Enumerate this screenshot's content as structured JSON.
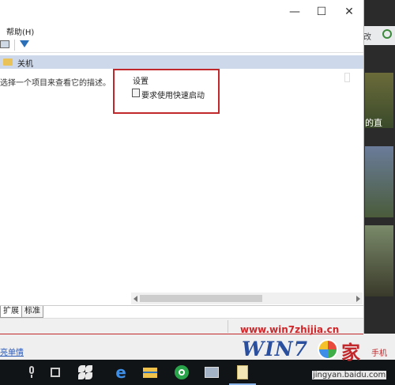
{
  "window": {
    "menu": {
      "help": "帮助(H)"
    },
    "header_row": {
      "label": "关机"
    },
    "description": "选择一个项目来查看它的描述。",
    "settings": {
      "heading": "设置",
      "item": "要求使用快速启动"
    },
    "tabs": [
      {
        "label": "扩展"
      },
      {
        "label": "标准"
      }
    ],
    "controls": {
      "minimize": "—",
      "maximize": "☐",
      "close": "✕"
    }
  },
  "background": {
    "sidebar_label": "改",
    "photo1_text": "的直",
    "friend_link": "亮单情",
    "mobile_text": "手机"
  },
  "watermark": {
    "url": "www.win7zhijia.cn",
    "brand": "WIN7",
    "char": "家",
    "sub": "jingyan.baidu.com"
  },
  "colors": {
    "highlight_border": "#c0282c",
    "header_row_bg": "#cdd9ea",
    "taskbar_bg": "#111417"
  },
  "icons": {
    "toolbar": [
      "console-tree-icon",
      "filter-icon"
    ],
    "header": "folder-icon",
    "setting": "policy-setting-icon",
    "taskbar": [
      "microphone-icon",
      "task-view-icon",
      "pinwheel-app-icon",
      "edge-icon",
      "file-explorer-icon",
      "green-app-icon",
      "photos-icon",
      "notepad-icon"
    ]
  }
}
